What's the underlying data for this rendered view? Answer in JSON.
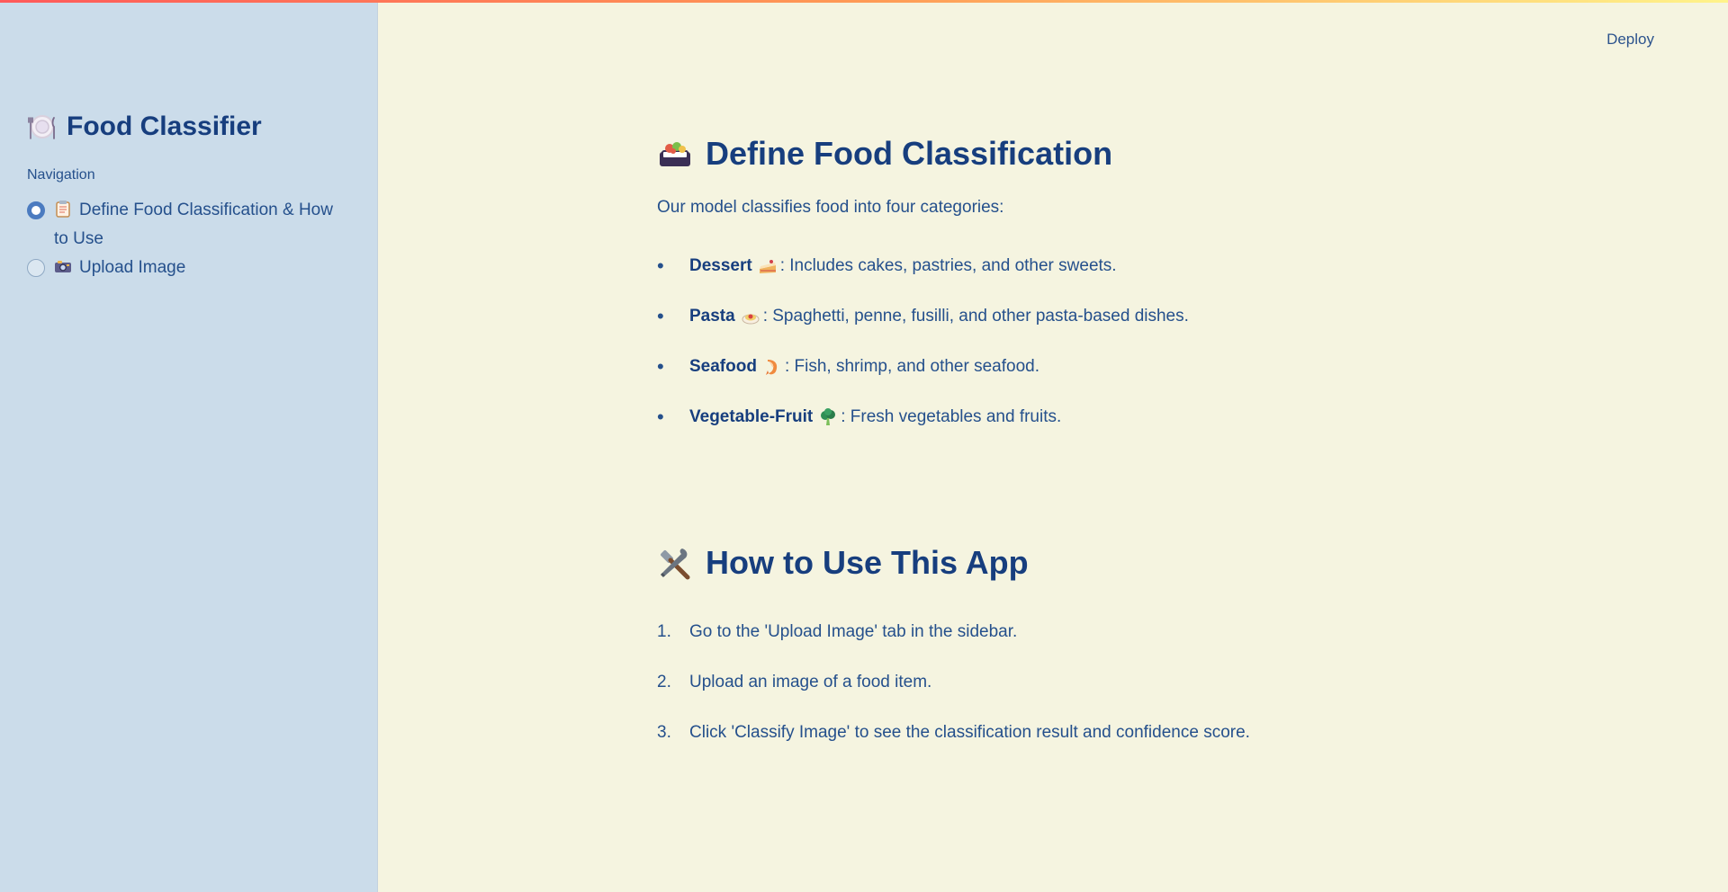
{
  "app": {
    "deploy_label": "Deploy",
    "accent_gradient": [
      "#ff5a5a",
      "#ff9a55",
      "#fff38a"
    ],
    "sidebar_bg": "#cbdcea",
    "main_bg": "#f5f4e0",
    "text_color": "#173e7e"
  },
  "sidebar": {
    "title": "Food Classifier",
    "title_icon": "plate-icon",
    "nav_label": "Navigation",
    "items": [
      {
        "label": "Define Food Classification & How to Use",
        "icon": "clipboard-icon",
        "selected": true
      },
      {
        "label": "Upload Image",
        "icon": "camera-icon",
        "selected": false
      }
    ]
  },
  "main": {
    "section1": {
      "title": "Define Food Classification",
      "icon": "bento-box-icon",
      "intro": "Our model classifies food into four categories:",
      "categories": [
        {
          "name": "Dessert",
          "icon": "cake-icon",
          "desc": ": Includes cakes, pastries, and other sweets."
        },
        {
          "name": "Pasta",
          "icon": "spaghetti-icon",
          "desc": ": Spaghetti, penne, fusilli, and other pasta-based dishes."
        },
        {
          "name": "Seafood",
          "icon": "shrimp-icon",
          "desc": ": Fish, shrimp, and other seafood."
        },
        {
          "name": "Vegetable-Fruit",
          "icon": "broccoli-icon",
          "desc": ": Fresh vegetables and fruits."
        }
      ]
    },
    "section2": {
      "title": "How to Use This App",
      "icon": "tools-icon",
      "steps": [
        "Go to the 'Upload Image' tab in the sidebar.",
        "Upload an image of a food item.",
        "Click 'Classify Image' to see the classification result and confidence score."
      ]
    }
  }
}
